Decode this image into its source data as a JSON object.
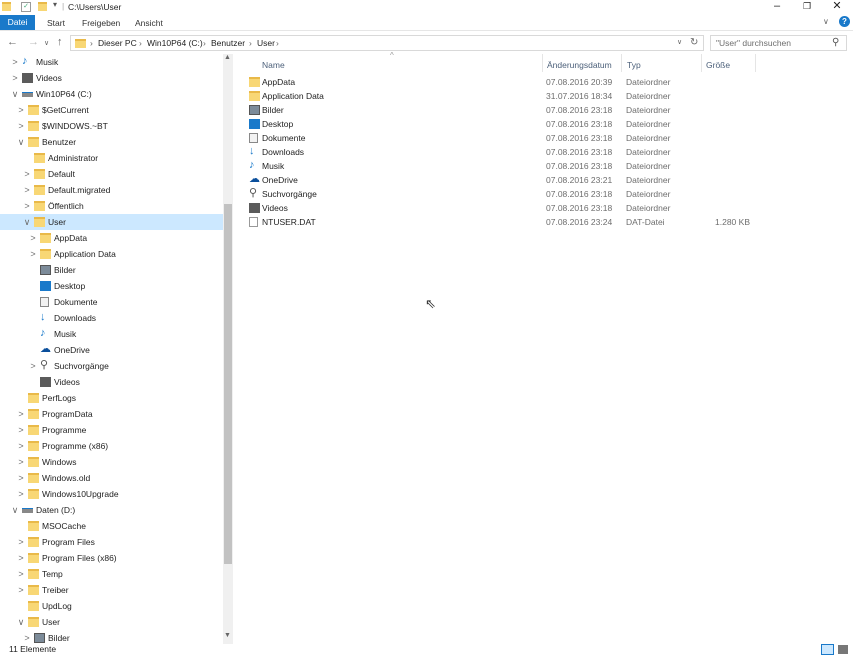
{
  "window": {
    "path_title": "C:\\Users\\User",
    "minimize": "–",
    "maximize": "❐",
    "close": "✕"
  },
  "ribbon": {
    "tabs": [
      "Datei",
      "Start",
      "Freigeben",
      "Ansicht"
    ],
    "help": "?",
    "collapse": "∨"
  },
  "address": {
    "segments": [
      "Dieser PC",
      "Win10P64 (C:)",
      "Benutzer",
      "User"
    ],
    "separator": "›"
  },
  "search": {
    "placeholder": "\"User\" durchsuchen"
  },
  "nav": [
    {
      "label": "Musik",
      "level": 1,
      "chev": ">",
      "icon": "music-icon"
    },
    {
      "label": "Videos",
      "level": 1,
      "chev": ">",
      "icon": "video-icon"
    },
    {
      "label": "Win10P64 (C:)",
      "level": 1,
      "chev": "∨",
      "icon": "drive-icon"
    },
    {
      "label": "$GetCurrent",
      "level": 2,
      "chev": ">",
      "icon": "folder-icon"
    },
    {
      "label": "$WINDOWS.~BT",
      "level": 2,
      "chev": ">",
      "icon": "folder-icon"
    },
    {
      "label": "Benutzer",
      "level": 2,
      "chev": "∨",
      "icon": "folder-icon"
    },
    {
      "label": "Administrator",
      "level": 3,
      "chev": "",
      "icon": "folder-icon"
    },
    {
      "label": "Default",
      "level": 3,
      "chev": ">",
      "icon": "folder-icon"
    },
    {
      "label": "Default.migrated",
      "level": 3,
      "chev": ">",
      "icon": "folder-icon"
    },
    {
      "label": "Öffentlich",
      "level": 3,
      "chev": ">",
      "icon": "folder-icon"
    },
    {
      "label": "User",
      "level": 3,
      "chev": "∨",
      "icon": "folder-icon",
      "selected": true
    },
    {
      "label": "AppData",
      "level": 4,
      "chev": ">",
      "icon": "folder-icon"
    },
    {
      "label": "Application Data",
      "level": 4,
      "chev": ">",
      "icon": "folder-icon"
    },
    {
      "label": "Bilder",
      "level": 4,
      "chev": "",
      "icon": "pictures-icon"
    },
    {
      "label": "Desktop",
      "level": 4,
      "chev": "",
      "icon": "desktop-icon"
    },
    {
      "label": "Dokumente",
      "level": 4,
      "chev": "",
      "icon": "documents-icon"
    },
    {
      "label": "Downloads",
      "level": 4,
      "chev": "",
      "icon": "downloads-icon"
    },
    {
      "label": "Musik",
      "level": 4,
      "chev": "",
      "icon": "music-icon"
    },
    {
      "label": "OneDrive",
      "level": 4,
      "chev": "",
      "icon": "onedrive-icon"
    },
    {
      "label": "Suchvorgänge",
      "level": 4,
      "chev": ">",
      "icon": "search-icon"
    },
    {
      "label": "Videos",
      "level": 4,
      "chev": "",
      "icon": "video-icon"
    },
    {
      "label": "PerfLogs",
      "level": 2,
      "chev": "",
      "icon": "folder-icon"
    },
    {
      "label": "ProgramData",
      "level": 2,
      "chev": ">",
      "icon": "folder-icon"
    },
    {
      "label": "Programme",
      "level": 2,
      "chev": ">",
      "icon": "folder-icon"
    },
    {
      "label": "Programme (x86)",
      "level": 2,
      "chev": ">",
      "icon": "folder-icon"
    },
    {
      "label": "Windows",
      "level": 2,
      "chev": ">",
      "icon": "folder-icon"
    },
    {
      "label": "Windows.old",
      "level": 2,
      "chev": ">",
      "icon": "folder-icon"
    },
    {
      "label": "Windows10Upgrade",
      "level": 2,
      "chev": ">",
      "icon": "folder-icon"
    },
    {
      "label": "Daten (D:)",
      "level": 1,
      "chev": "∨",
      "icon": "drive-icon"
    },
    {
      "label": "MSOCache",
      "level": 2,
      "chev": "",
      "icon": "folder-icon"
    },
    {
      "label": "Program Files",
      "level": 2,
      "chev": ">",
      "icon": "folder-icon"
    },
    {
      "label": "Program Files (x86)",
      "level": 2,
      "chev": ">",
      "icon": "folder-icon"
    },
    {
      "label": "Temp",
      "level": 2,
      "chev": ">",
      "icon": "folder-icon"
    },
    {
      "label": "Treiber",
      "level": 2,
      "chev": ">",
      "icon": "folder-icon"
    },
    {
      "label": "UpdLog",
      "level": 2,
      "chev": "",
      "icon": "folder-icon"
    },
    {
      "label": "User",
      "level": 2,
      "chev": "∨",
      "icon": "folder-icon"
    },
    {
      "label": "Bilder",
      "level": 3,
      "chev": ">",
      "icon": "pictures-icon"
    }
  ],
  "columns": {
    "name": "Name",
    "date": "Änderungsdatum",
    "type": "Typ",
    "size": "Größe",
    "sort_indicator": "^"
  },
  "files": [
    {
      "name": "AppData",
      "date": "07.08.2016 20:39",
      "type": "Dateiordner",
      "size": "",
      "icon": "folder-icon"
    },
    {
      "name": "Application Data",
      "date": "31.07.2016 18:34",
      "type": "Dateiordner",
      "size": "",
      "icon": "folder-icon"
    },
    {
      "name": "Bilder",
      "date": "07.08.2016 23:18",
      "type": "Dateiordner",
      "size": "",
      "icon": "pictures-icon"
    },
    {
      "name": "Desktop",
      "date": "07.08.2016 23:18",
      "type": "Dateiordner",
      "size": "",
      "icon": "desktop-icon"
    },
    {
      "name": "Dokumente",
      "date": "07.08.2016 23:18",
      "type": "Dateiordner",
      "size": "",
      "icon": "documents-icon"
    },
    {
      "name": "Downloads",
      "date": "07.08.2016 23:18",
      "type": "Dateiordner",
      "size": "",
      "icon": "downloads-icon"
    },
    {
      "name": "Musik",
      "date": "07.08.2016 23:18",
      "type": "Dateiordner",
      "size": "",
      "icon": "music-icon"
    },
    {
      "name": "OneDrive",
      "date": "07.08.2016 23:21",
      "type": "Dateiordner",
      "size": "",
      "icon": "onedrive-icon"
    },
    {
      "name": "Suchvorgänge",
      "date": "07.08.2016 23:18",
      "type": "Dateiordner",
      "size": "",
      "icon": "search-icon"
    },
    {
      "name": "Videos",
      "date": "07.08.2016 23:18",
      "type": "Dateiordner",
      "size": "",
      "icon": "video-icon"
    },
    {
      "name": "NTUSER.DAT",
      "date": "07.08.2016 23:24",
      "type": "DAT-Datei",
      "size": "1.280 KB",
      "icon": "file-icon"
    }
  ],
  "status": {
    "count": "11 Elemente"
  },
  "colors": {
    "accent": "#1979ca",
    "selection": "#cce8ff",
    "folder": "#f8d775"
  }
}
